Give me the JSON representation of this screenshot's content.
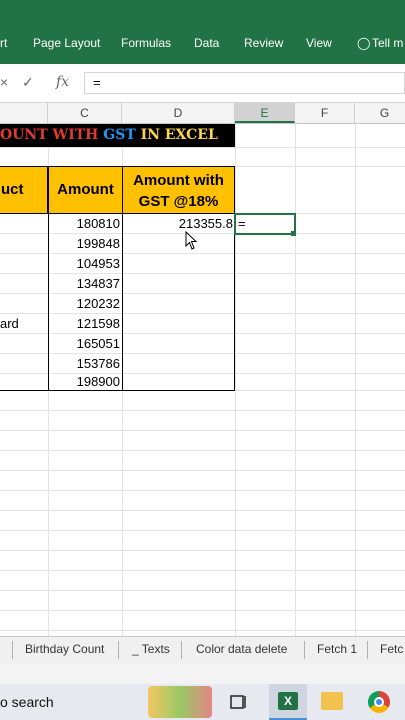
{
  "ribbon": {
    "tabs": [
      "rt",
      "Page Layout",
      "Formulas",
      "Data",
      "Review",
      "View",
      "Tell m"
    ]
  },
  "formula_bar": {
    "value": "=",
    "cancel_icon": "×",
    "enter_icon": "✓",
    "fx_label": "fx"
  },
  "columns": [
    "C",
    "D",
    "E",
    "F",
    "G"
  ],
  "title": {
    "part1": "OUNT WITH ",
    "part2": "GST",
    "part3": " IN EXCEL"
  },
  "table": {
    "header_product": "uct",
    "header_amount": "Amount",
    "header_gst_line1": "Amount with",
    "header_gst_line2": "GST @18%",
    "amounts": [
      "180810",
      "199848",
      "104953",
      "134837",
      "120232",
      "121598",
      "165051",
      "153786",
      "198900"
    ],
    "product_fragment": "ard",
    "gst_first": "213355.8"
  },
  "active_cell": {
    "value": "="
  },
  "sheet_tabs": [
    "Birthday Count",
    "_ Texts",
    "Color data delete",
    "Fetch 1",
    "Fetc"
  ],
  "taskbar": {
    "search_text": "o search"
  }
}
